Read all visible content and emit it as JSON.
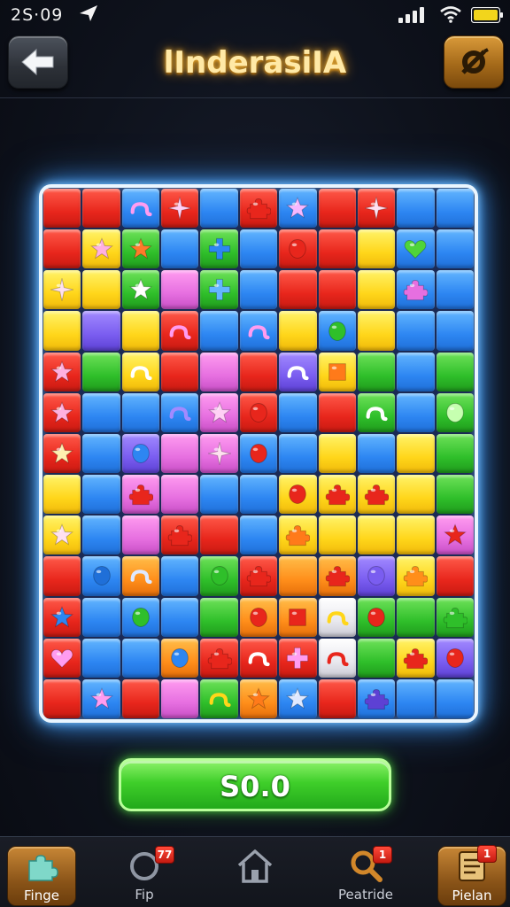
{
  "status_bar": {
    "time": "2S·09"
  },
  "header": {
    "title": "lInderasiIA"
  },
  "colors": {
    "title_glow": "#f5b93a",
    "board_glow": "#3f9cff",
    "score_button": "#3fcf2a",
    "badge": "#e0281c"
  },
  "icons": {
    "back": "back-arrow-icon",
    "settings": "settings-ring-icon"
  },
  "board": {
    "columns": 11,
    "rows": 13,
    "grid": [
      [
        "red",
        "red",
        "blue",
        "red",
        "blue",
        "red",
        "blue",
        "red",
        "red",
        "blue",
        "blue"
      ],
      [
        "red",
        "yellow",
        "green",
        "blue",
        "green",
        "blue",
        "red",
        "red",
        "yellow",
        "blue",
        "blue"
      ],
      [
        "yellow",
        "yellow",
        "green",
        "pink",
        "green",
        "blue",
        "red",
        "red",
        "yellow",
        "blue",
        "blue"
      ],
      [
        "yellow",
        "purple",
        "yellow",
        "red",
        "blue",
        "blue",
        "yellow",
        "blue",
        "yellow",
        "blue",
        "blue"
      ],
      [
        "red",
        "green",
        "yellow",
        "red",
        "pink",
        "red",
        "purple",
        "yellow",
        "green",
        "blue",
        "green"
      ],
      [
        "red",
        "blue",
        "blue",
        "blue",
        "pink",
        "red",
        "blue",
        "red",
        "green",
        "blue",
        "green"
      ],
      [
        "red",
        "blue",
        "purple",
        "pink",
        "pink",
        "blue",
        "blue",
        "yellow",
        "blue",
        "yellow",
        "green"
      ],
      [
        "yellow",
        "blue",
        "pink",
        "pink",
        "blue",
        "blue",
        "yellow",
        "yellow",
        "yellow",
        "yellow",
        "green"
      ],
      [
        "yellow",
        "blue",
        "pink",
        "red",
        "red",
        "blue",
        "yellow",
        "yellow",
        "yellow",
        "yellow",
        "pink"
      ],
      [
        "red",
        "blue",
        "orange",
        "blue",
        "green",
        "red",
        "orange",
        "orange",
        "purple",
        "yellow",
        "red"
      ],
      [
        "red",
        "blue",
        "blue",
        "blue",
        "green",
        "orange",
        "orange",
        "white",
        "green",
        "green",
        "green"
      ],
      [
        "red",
        "blue",
        "blue",
        "orange",
        "red",
        "red",
        "red",
        "white",
        "green",
        "yellow",
        "purple"
      ],
      [
        "red",
        "blue",
        "red",
        "pink",
        "green",
        "orange",
        "blue",
        "red",
        "blue",
        "blue",
        "blue"
      ]
    ],
    "pieces": [
      {
        "row": 0,
        "col": 2,
        "shape": "candy-icon",
        "color": "#ff9cf0"
      },
      {
        "row": 0,
        "col": 3,
        "shape": "sparkle-icon",
        "color": "#ffd0f5"
      },
      {
        "row": 0,
        "col": 5,
        "shape": "puzzle-icon",
        "color": "#e8261c"
      },
      {
        "row": 0,
        "col": 6,
        "shape": "star-icon",
        "color": "#f6b8ff"
      },
      {
        "row": 0,
        "col": 8,
        "shape": "sparkle-icon",
        "color": "#ffe0f0"
      },
      {
        "row": 1,
        "col": 1,
        "shape": "star-icon",
        "color": "#ffb0e0"
      },
      {
        "row": 1,
        "col": 2,
        "shape": "star-icon",
        "color": "#ff7a2a"
      },
      {
        "row": 1,
        "col": 4,
        "shape": "cross-icon",
        "color": "#2d86f2"
      },
      {
        "row": 1,
        "col": 6,
        "shape": "drop-icon",
        "color": "#e8261c"
      },
      {
        "row": 1,
        "col": 9,
        "shape": "heart-icon",
        "color": "#4fd43a"
      },
      {
        "row": 2,
        "col": 0,
        "shape": "sparkle-icon",
        "color": "#ffe0f0"
      },
      {
        "row": 2,
        "col": 2,
        "shape": "star-icon",
        "color": "#ffffff"
      },
      {
        "row": 2,
        "col": 4,
        "shape": "cross-icon",
        "color": "#63b6ff"
      },
      {
        "row": 2,
        "col": 9,
        "shape": "puzzle-icon",
        "color": "#e66fe0"
      },
      {
        "row": 3,
        "col": 3,
        "shape": "candy-icon",
        "color": "#ff9cf0"
      },
      {
        "row": 3,
        "col": 5,
        "shape": "candy-icon",
        "color": "#ff9cf0"
      },
      {
        "row": 3,
        "col": 7,
        "shape": "drop-icon",
        "color": "#2fbf2a"
      },
      {
        "row": 4,
        "col": 0,
        "shape": "star-icon",
        "color": "#ffb0e0"
      },
      {
        "row": 4,
        "col": 2,
        "shape": "candy-icon",
        "color": "#ffffff"
      },
      {
        "row": 4,
        "col": 6,
        "shape": "candy-icon",
        "color": "#ffffff"
      },
      {
        "row": 4,
        "col": 7,
        "shape": "gem-icon",
        "color": "#ff7a1a"
      },
      {
        "row": 5,
        "col": 0,
        "shape": "star-icon",
        "color": "#ffb0e0"
      },
      {
        "row": 5,
        "col": 3,
        "shape": "candy-icon",
        "color": "#a28aff"
      },
      {
        "row": 5,
        "col": 4,
        "shape": "star-icon",
        "color": "#ffd0f5"
      },
      {
        "row": 5,
        "col": 5,
        "shape": "drop-icon",
        "color": "#e8261c"
      },
      {
        "row": 5,
        "col": 8,
        "shape": "candy-icon",
        "color": "#ffffff"
      },
      {
        "row": 5,
        "col": 10,
        "shape": "drop-icon",
        "color": "#c6ffb0"
      },
      {
        "row": 6,
        "col": 0,
        "shape": "star-icon",
        "color": "#fff0b0"
      },
      {
        "row": 6,
        "col": 2,
        "shape": "drop-icon",
        "color": "#2d86f2"
      },
      {
        "row": 6,
        "col": 4,
        "shape": "sparkle-icon",
        "color": "#ffe0f0"
      },
      {
        "row": 6,
        "col": 5,
        "shape": "drop-icon",
        "color": "#e8261c"
      },
      {
        "row": 7,
        "col": 2,
        "shape": "puzzle-icon",
        "color": "#e8261c"
      },
      {
        "row": 7,
        "col": 6,
        "shape": "drop-icon",
        "color": "#e8261c"
      },
      {
        "row": 7,
        "col": 7,
        "shape": "puzzle-icon",
        "color": "#e8261c"
      },
      {
        "row": 7,
        "col": 8,
        "shape": "puzzle-icon",
        "color": "#e8261c"
      },
      {
        "row": 8,
        "col": 0,
        "shape": "star-icon",
        "color": "#ffe0f0"
      },
      {
        "row": 8,
        "col": 3,
        "shape": "puzzle-icon",
        "color": "#e8261c"
      },
      {
        "row": 8,
        "col": 6,
        "shape": "puzzle-icon",
        "color": "#ff7a1a"
      },
      {
        "row": 8,
        "col": 10,
        "shape": "star-icon",
        "color": "#e8261c"
      },
      {
        "row": 9,
        "col": 1,
        "shape": "drop-icon",
        "color": "#1f6fd8"
      },
      {
        "row": 9,
        "col": 2,
        "shape": "candy-icon",
        "color": "#dfe9ff"
      },
      {
        "row": 9,
        "col": 4,
        "shape": "drop-icon",
        "color": "#2fbf2a"
      },
      {
        "row": 9,
        "col": 5,
        "shape": "puzzle-icon",
        "color": "#e8261c"
      },
      {
        "row": 9,
        "col": 7,
        "shape": "puzzle-icon",
        "color": "#e8261c"
      },
      {
        "row": 9,
        "col": 8,
        "shape": "drop-icon",
        "color": "#7a5df0"
      },
      {
        "row": 9,
        "col": 9,
        "shape": "puzzle-icon",
        "color": "#ff8e1a"
      },
      {
        "row": 10,
        "col": 0,
        "shape": "star-icon",
        "color": "#2d86f2"
      },
      {
        "row": 10,
        "col": 2,
        "shape": "drop-icon",
        "color": "#2fbf2a"
      },
      {
        "row": 10,
        "col": 5,
        "shape": "drop-icon",
        "color": "#e8261c"
      },
      {
        "row": 10,
        "col": 6,
        "shape": "gem-icon",
        "color": "#e8261c"
      },
      {
        "row": 10,
        "col": 7,
        "shape": "candy-icon",
        "color": "#ffd61a"
      },
      {
        "row": 10,
        "col": 8,
        "shape": "drop-icon",
        "color": "#e8261c"
      },
      {
        "row": 10,
        "col": 10,
        "shape": "puzzle-icon",
        "color": "#2fbf2a"
      },
      {
        "row": 11,
        "col": 0,
        "shape": "heart-icon",
        "color": "#ff9cf0"
      },
      {
        "row": 11,
        "col": 3,
        "shape": "drop-icon",
        "color": "#2d86f2"
      },
      {
        "row": 11,
        "col": 4,
        "shape": "puzzle-icon",
        "color": "#e8261c"
      },
      {
        "row": 11,
        "col": 5,
        "shape": "candy-icon",
        "color": "#ffffff"
      },
      {
        "row": 11,
        "col": 6,
        "shape": "cross-icon",
        "color": "#ff9cf0"
      },
      {
        "row": 11,
        "col": 7,
        "shape": "candy-icon",
        "color": "#e8261c"
      },
      {
        "row": 11,
        "col": 9,
        "shape": "puzzle-icon",
        "color": "#e8261c"
      },
      {
        "row": 11,
        "col": 10,
        "shape": "drop-icon",
        "color": "#e8261c"
      },
      {
        "row": 12,
        "col": 1,
        "shape": "star-icon",
        "color": "#ff9cf0"
      },
      {
        "row": 12,
        "col": 4,
        "shape": "candy-icon",
        "color": "#ffd61a"
      },
      {
        "row": 12,
        "col": 5,
        "shape": "star-icon",
        "color": "#ff7a1a"
      },
      {
        "row": 12,
        "col": 6,
        "shape": "star-icon",
        "color": "#dfe9ff"
      },
      {
        "row": 12,
        "col": 8,
        "shape": "puzzle-icon",
        "color": "#5d41d4"
      }
    ]
  },
  "action_button": {
    "label": "S0.0"
  },
  "bottom_nav": {
    "items": [
      {
        "id": "finge",
        "label": "Finge",
        "icon": "puzzle-piece-icon",
        "badge": ""
      },
      {
        "id": "fip",
        "label": "Fip",
        "icon": "ring-icon",
        "badge": "77"
      },
      {
        "id": "home",
        "label": "",
        "icon": "home-icon",
        "badge": ""
      },
      {
        "id": "peatride",
        "label": "Peatride",
        "icon": "search-icon",
        "badge": "1"
      },
      {
        "id": "pielan",
        "label": "Pielan",
        "icon": "document-icon",
        "badge": "1"
      }
    ]
  }
}
